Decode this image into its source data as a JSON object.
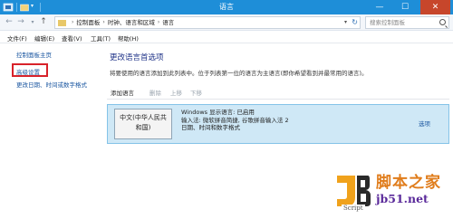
{
  "window": {
    "title": "语言",
    "minimize_glyph": "—",
    "maximize_glyph": "☐",
    "close_glyph": "✕"
  },
  "address_bar": {
    "back_glyph": "←",
    "forward_glyph": "→",
    "recent_glyph": "▾",
    "up_glyph": "↑",
    "breadcrumbs": [
      "控制面板",
      "时钟、语言和区域",
      "语言"
    ],
    "search_placeholder": "搜索控制面板"
  },
  "menu": [
    "文件(F)",
    "编辑(E)",
    "查看(V)",
    "工具(T)",
    "帮助(H)"
  ],
  "sidebar": {
    "items": [
      "控制面板主页",
      "高级设置",
      "更改日期、时间或数字格式"
    ]
  },
  "main": {
    "title": "更改语言首选项",
    "description": "将要使用的语言添加到此列表中。位于列表第一位的语言为主语言(即你希望看到并最常用的语言)。",
    "toolbar": {
      "add": "添加语言",
      "remove": "删除",
      "move_up": "上移",
      "move_down": "下移"
    },
    "language": {
      "tile_line1": "中文(中华人民共",
      "tile_line2": "和国)",
      "info_line1": "Windows 显示语言: 已启用",
      "info_line2": "输入法: 微软拼音简捷, 谷歌拼音输入法 2",
      "info_line3": "日期、时间和数字格式",
      "options": "选项"
    }
  },
  "watermark": {
    "title": "脚本之家",
    "url": "jb51.net",
    "script": "Script"
  },
  "colors": {
    "titlebar": "#1e8ed8",
    "close_button": "#c7462b",
    "selected_row": "#cfe8f6",
    "link": "#1a56a0",
    "highlight_box": "#d8222a"
  }
}
